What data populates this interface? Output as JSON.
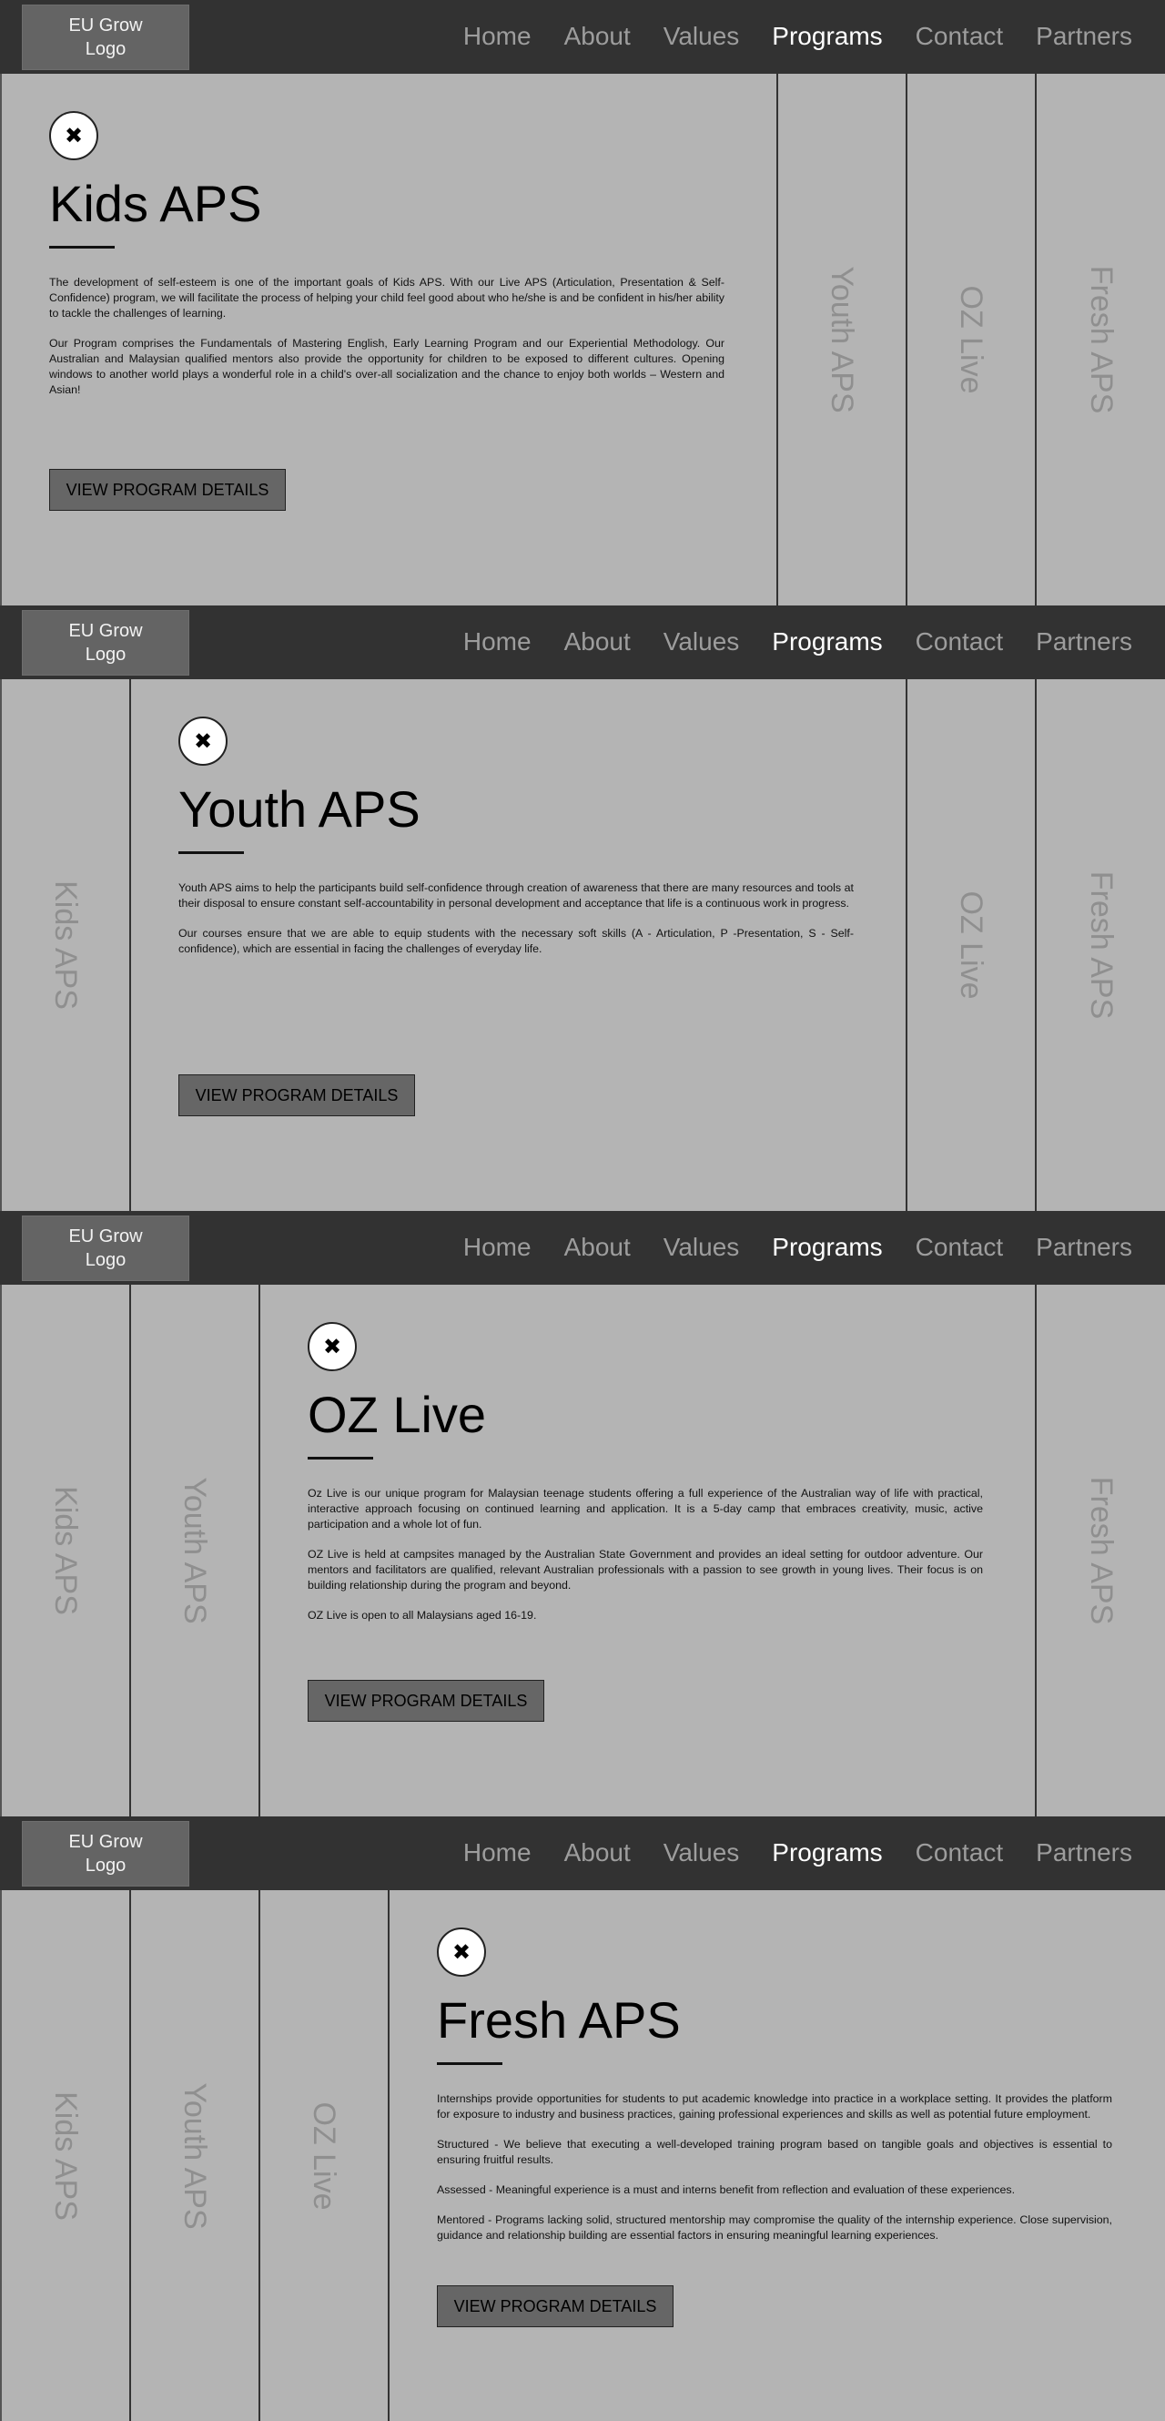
{
  "header": {
    "logo_line1": "EU Grow",
    "logo_line2": "Logo",
    "nav": [
      "Home",
      "About",
      "Values",
      "Programs",
      "Contact",
      "Partners"
    ],
    "active_nav": "Programs"
  },
  "programs": {
    "kids": {
      "name": "Kids APS",
      "paragraphs": [
        "The development of self-esteem is one of the important goals of Kids APS. With our Live APS (Articulation, Presentation & Self-Confidence) program, we will facilitate the process of helping your child feel good about who he/she is and be confident in his/her ability to tackle the challenges of learning.",
        "Our Program comprises the Fundamentals of Mastering English, Early Learning Program and our Experiential Methodology. Our Australian and Malaysian qualified mentors also provide the opportunity for children to be exposed to different cultures. Opening windows to another world plays a wonderful role in a child's over-all socialization and the chance to enjoy both worlds – Western and Asian!"
      ]
    },
    "youth": {
      "name": "Youth APS",
      "paragraphs": [
        "Youth APS aims to help the participants build self-confidence through creation of awareness that there are many resources and tools at their disposal to ensure constant self-accountability in personal development and acceptance that life is a continuous work in progress.",
        "Our courses ensure that we are able to equip students with the necessary soft skills (A - Articulation, P -Presentation, S - Self-confidence), which are essential in facing the challenges of everyday life."
      ]
    },
    "oz": {
      "name": "OZ Live",
      "paragraphs": [
        "Oz Live is our unique program for Malaysian teenage students offering a full experience of the Australian way of life with practical, interactive approach focusing on continued learning and application. It is a 5-day camp that embraces creativity, music, active participation and a whole lot of fun.",
        "OZ Live is held at campsites managed by the Australian State Government and provides an ideal setting for outdoor adventure. Our mentors and facilitators are qualified, relevant Australian professionals with a passion to see growth in young lives. Their focus is on building relationship during the program and beyond.",
        "OZ Live is open to all Malaysians aged 16-19."
      ]
    },
    "fresh": {
      "name": "Fresh APS",
      "paragraphs": [
        "Internships provide opportunities for students to put academic knowledge into practice in a workplace setting. It provides the platform for exposure to industry and business practices, gaining professional experiences and skills as well as potential future employment.",
        "Structured - We believe that executing a well-developed training program based on tangible goals and objectives is essential to ensuring fruitful results.",
        "Assessed - Meaningful experience is a must and interns benefit from reflection and evaluation of these experiences.",
        "Mentored - Programs lacking solid, structured mentorship may compromise the quality of the internship experience. Close supervision, guidance and relationship building are essential factors in ensuring meaningful learning experiences."
      ]
    }
  },
  "details_button_label": "VIEW PROGRAM DETAILS",
  "close_icon": "close-icon",
  "colors": {
    "header_bg": "#323232",
    "page_bg": "#b4b4b4",
    "logo_bg": "#646464",
    "nav_inactive": "#9d9d9d",
    "nav_active": "#ffffff",
    "button_bg": "#666666"
  }
}
